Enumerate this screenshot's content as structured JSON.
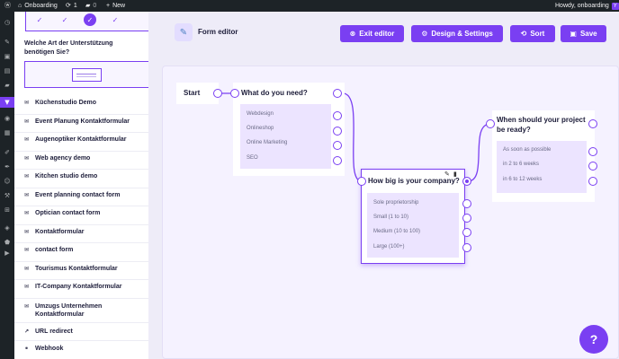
{
  "admin_bar": {
    "site_name": "Onboarding",
    "updates_count": "1",
    "comments_count": "0",
    "new_label": "New",
    "howdy": "Howdy, onboarding"
  },
  "sidebar": {
    "question_label": "Welche Art der Unterstützung benötigen Sie?",
    "templates": [
      "Küchenstudio Demo",
      "Event Planung Kontaktformular",
      "Augenoptiker Kontaktformular",
      "Web agency demo",
      "Kitchen studio demo",
      "Event planning contact form",
      "Optician contact form",
      "Kontaktformular",
      "contact form",
      "Tourismus Kontaktformular",
      "IT-Company Kontaktformular",
      "Umzugs Unternehmen Kontaktformular",
      "URL redirect",
      "Webhook"
    ]
  },
  "toolbar": {
    "title": "Form editor",
    "exit_label": "Exit editor",
    "design_label": "Design & Settings",
    "sort_label": "Sort",
    "save_label": "Save"
  },
  "canvas": {
    "start_label": "Start",
    "nodes": [
      {
        "title": "What do you need?",
        "options": [
          "Webdesign",
          "Onlineshop",
          "Online Marketing",
          "SEO"
        ]
      },
      {
        "title": "How big is your company?",
        "options": [
          "Sole proprietorship",
          "Small (1 to 10)",
          "Medium (10 to 100)",
          "Large (100+)"
        ]
      },
      {
        "title": "When should your project be ready?",
        "options": [
          "As soon as possible",
          "in 2 to 6 weeks",
          "in 6 to 12 weeks"
        ]
      }
    ]
  },
  "help_label": "?",
  "colors": {
    "accent": "#7a3ff2",
    "admin_bar": "#1d2327",
    "canvas_bg": "#f5f2ff",
    "option_bg": "#ece4ff"
  }
}
